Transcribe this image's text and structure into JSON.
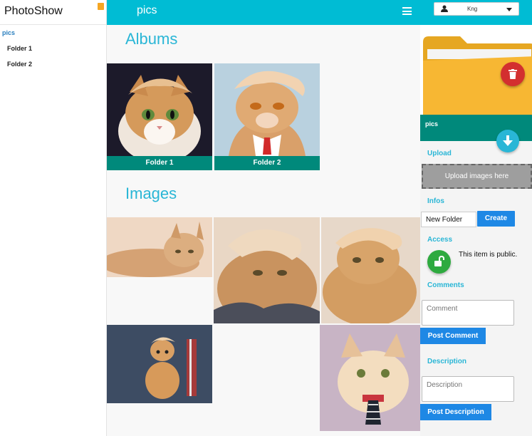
{
  "app": {
    "title": "PhotoShow"
  },
  "sidebar": {
    "root": "pics",
    "items": [
      {
        "label": "Folder 1"
      },
      {
        "label": "Folder 2"
      }
    ]
  },
  "topbar": {
    "title": "pics"
  },
  "main": {
    "albums_title": "Albums",
    "images_title": "Images",
    "albums": [
      {
        "label": "Folder 1"
      },
      {
        "label": "Folder 2"
      }
    ]
  },
  "panel": {
    "user": {
      "name": "Kng"
    },
    "folder_name": "pics",
    "upload": {
      "heading": "Upload",
      "drop_label": "Upload images here"
    },
    "infos": {
      "heading": "Infos",
      "folder_input_value": "New Folder",
      "create_label": "Create"
    },
    "access": {
      "heading": "Access",
      "status_text": "This item is public."
    },
    "comments": {
      "heading": "Comments",
      "placeholder": "Comment",
      "button_label": "Post Comment"
    },
    "description": {
      "heading": "Description",
      "placeholder": "Description",
      "button_label": "Post Description"
    }
  },
  "icons": {
    "brand_badge": "orange-square-icon",
    "menu": "hamburger-menu-icon",
    "user": "user-icon",
    "delete": "trash-icon",
    "download": "arrow-down-icon",
    "lock": "unlocked-padlock-icon",
    "folder": "folder-icon"
  },
  "colors": {
    "accent": "#00bcd4",
    "teal": "#00897b",
    "primary_button": "#1e88e5",
    "danger": "#d32f2f",
    "success": "#2eaa3f",
    "heading": "#29b6d6"
  }
}
